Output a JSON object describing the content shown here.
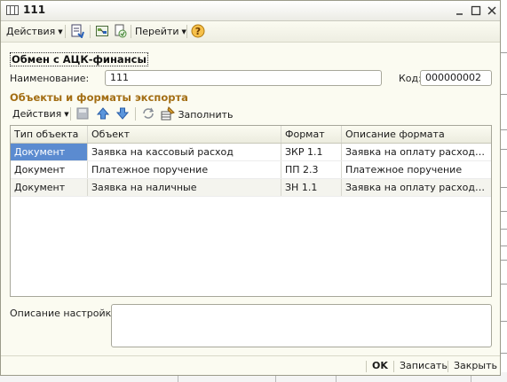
{
  "window": {
    "title": "111"
  },
  "toolbar": {
    "actions_label": "Действия",
    "goto_label": "Перейти"
  },
  "header": {
    "title": "Обмен с АЦК-финансы"
  },
  "form": {
    "name_label": "Наименование:",
    "name_value": "111",
    "code_label": "Код:",
    "code_value": "000000002"
  },
  "objects": {
    "section_title": "Объекты и форматы экспорта",
    "actions_label": "Действия",
    "fill_label": "Заполнить",
    "columns": [
      "Тип объекта",
      "Объект",
      "Формат",
      "Описание формата"
    ],
    "rows": [
      [
        "Документ",
        "Заявка на кассовый расход",
        "ЗКР 1.1",
        "Заявка на оплату расходов (З..."
      ],
      [
        "Документ",
        "Платежное поручение",
        "ПП 2.3",
        "Платежное поручение"
      ],
      [
        "Документ",
        "Заявка на наличные",
        "ЗН 1.1",
        "Заявка на оплату расходов (З..."
      ]
    ]
  },
  "description": {
    "label": "Описание настройки:",
    "value": ""
  },
  "footer": {
    "ok_label": "OK",
    "save_label": "Записать",
    "close_label": "Закрыть"
  },
  "colors": {
    "accent_section": "#a36e14",
    "selection": "#5b8bd0",
    "window_bg": "#fbfbf1"
  },
  "icons": {
    "app": "table-icon",
    "toolbar": [
      "post-document-icon",
      "structure-icon",
      "print-icon",
      "help-icon"
    ],
    "sub_toolbar": [
      "save-icon",
      "move-up-icon",
      "move-down-icon",
      "refresh-icon",
      "fill-icon"
    ]
  }
}
